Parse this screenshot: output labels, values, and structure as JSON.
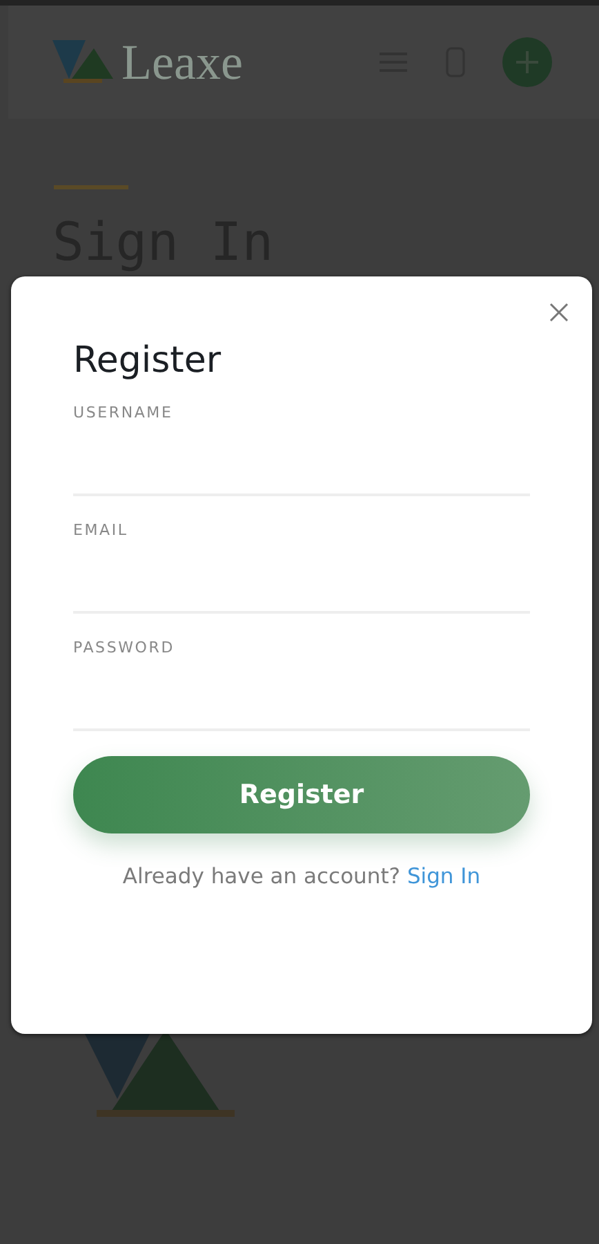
{
  "header": {
    "logo_text": "Leaxe"
  },
  "page": {
    "title": "Sign In"
  },
  "modal": {
    "title": "Register",
    "fields": [
      {
        "label": "USERNAME"
      },
      {
        "label": "EMAIL"
      },
      {
        "label": "PASSWORD"
      }
    ],
    "button": "Register",
    "footer": {
      "text": "Already have an account?",
      "link": "Sign In"
    }
  }
}
